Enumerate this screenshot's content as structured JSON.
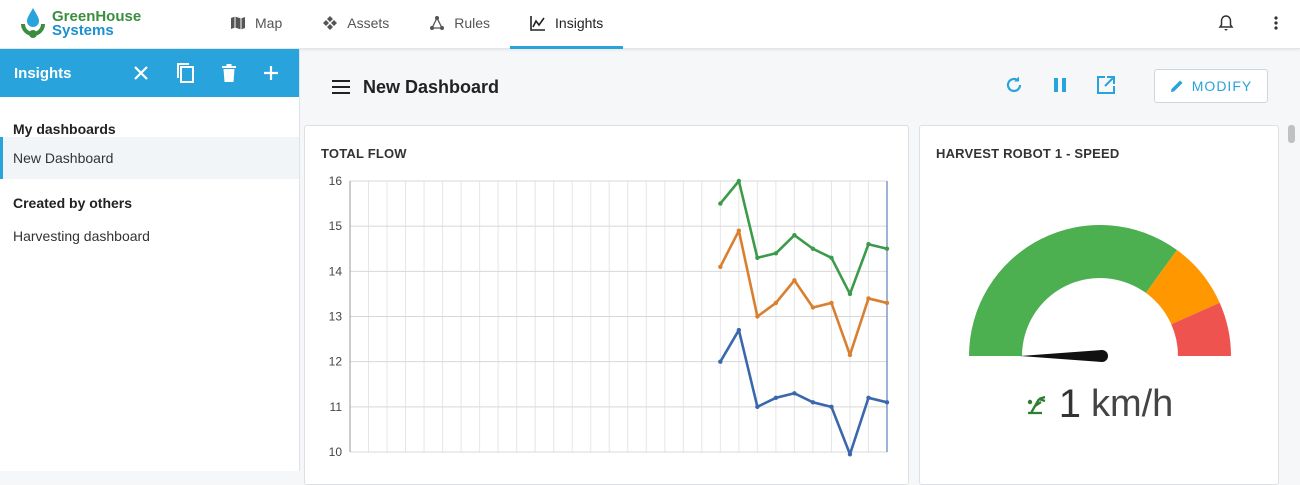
{
  "brand": {
    "line1": "GreenHouse",
    "line2": "Systems"
  },
  "nav": [
    {
      "label": "Map",
      "icon": "map-icon"
    },
    {
      "label": "Assets",
      "icon": "assets-icon"
    },
    {
      "label": "Rules",
      "icon": "rules-icon"
    },
    {
      "label": "Insights",
      "icon": "insights-icon",
      "active": true
    }
  ],
  "sidebar": {
    "title": "Insights",
    "sections": [
      {
        "heading": "My dashboards",
        "items": [
          {
            "label": "New Dashboard",
            "active": true
          }
        ]
      },
      {
        "heading": "Created by others",
        "items": [
          {
            "label": "Harvesting dashboard"
          }
        ]
      }
    ]
  },
  "dashboard": {
    "title": "New Dashboard",
    "modify_label": "MODIFY"
  },
  "widgets": {
    "flow": {
      "title": "TOTAL FLOW"
    },
    "speed": {
      "title": "HARVEST ROBOT 1 - SPEED",
      "value": "1",
      "unit": "km/h"
    }
  },
  "colors": {
    "accent": "#29a3dc",
    "series_green": "#3c9a4b",
    "series_orange": "#d97f2f",
    "series_blue": "#3b68ad",
    "gauge_green": "#4caf50",
    "gauge_orange": "#ff9800",
    "gauge_red": "#ef5350"
  },
  "chart_data": {
    "type": "line",
    "title": "TOTAL FLOW",
    "ylim": [
      10,
      16
    ],
    "yticks": [
      10,
      11,
      12,
      13,
      14,
      15,
      16
    ],
    "grid": true,
    "series": [
      {
        "color": "#3c9a4b",
        "points": [
          [
            20,
            15.5
          ],
          [
            21,
            16.0
          ],
          [
            22,
            14.3
          ],
          [
            23,
            14.4
          ],
          [
            24,
            14.8
          ],
          [
            25,
            14.5
          ],
          [
            26,
            14.3
          ],
          [
            27,
            13.5
          ],
          [
            28,
            14.6
          ],
          [
            29,
            14.5
          ]
        ]
      },
      {
        "color": "#d97f2f",
        "points": [
          [
            20,
            14.1
          ],
          [
            21,
            14.9
          ],
          [
            22,
            13.0
          ],
          [
            23,
            13.3
          ],
          [
            24,
            13.8
          ],
          [
            25,
            13.2
          ],
          [
            26,
            13.3
          ],
          [
            27,
            12.15
          ],
          [
            28,
            13.4
          ],
          [
            29,
            13.3
          ]
        ]
      },
      {
        "color": "#3b68ad",
        "points": [
          [
            20,
            12.0
          ],
          [
            21,
            12.7
          ],
          [
            22,
            11.0
          ],
          [
            23,
            11.2
          ],
          [
            24,
            11.3
          ],
          [
            25,
            11.1
          ],
          [
            26,
            11.0
          ],
          [
            27,
            9.95
          ],
          [
            28,
            11.2
          ],
          [
            29,
            11.1
          ]
        ]
      }
    ],
    "x_count": 30
  },
  "gauge": {
    "min": 0,
    "max": 3,
    "value": 1,
    "bands": [
      {
        "to": 2.1,
        "color": "#4caf50"
      },
      {
        "to": 2.6,
        "color": "#ff9800"
      },
      {
        "to": 3,
        "color": "#ef5350"
      }
    ]
  }
}
